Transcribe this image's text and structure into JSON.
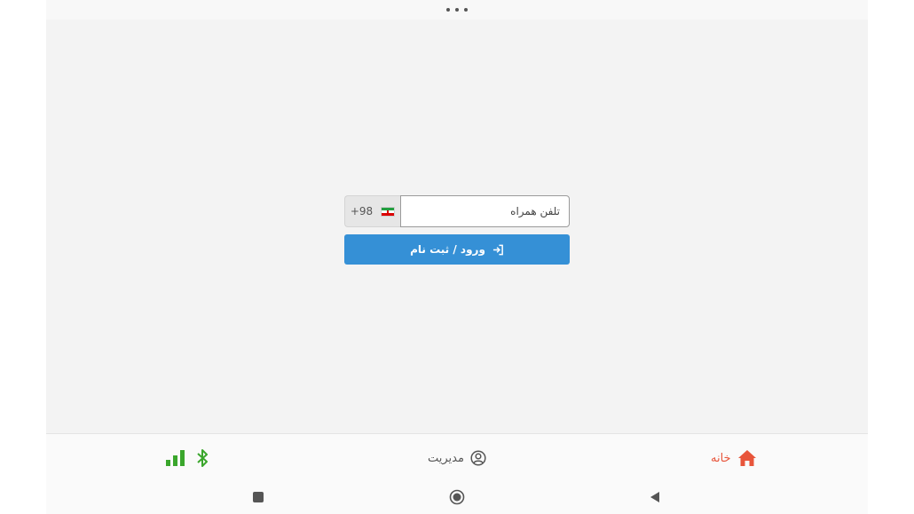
{
  "topbar": {
    "menu_icon": "more-horizontal-icon"
  },
  "login": {
    "country_code": "+98",
    "flag_icon": "iran-flag-icon",
    "phone_placeholder": "تلفن همراه",
    "phone_value": "",
    "submit_label": "ورود / ثبت نام",
    "submit_icon": "sign-in-icon"
  },
  "nav": {
    "home_label": "خانه",
    "home_icon": "home-icon",
    "admin_label": "مدیریت",
    "admin_icon": "user-circle-icon",
    "status_icons": [
      "signal-bars-icon",
      "bluetooth-icon"
    ]
  },
  "system_nav": {
    "recent": "recent-apps-icon",
    "home": "home-circle-icon",
    "back": "back-triangle-icon"
  },
  "colors": {
    "primary": "#3590d6",
    "home_accent": "#e8553b",
    "status_green": "#3aa62c",
    "background": "#f3f3f3"
  }
}
